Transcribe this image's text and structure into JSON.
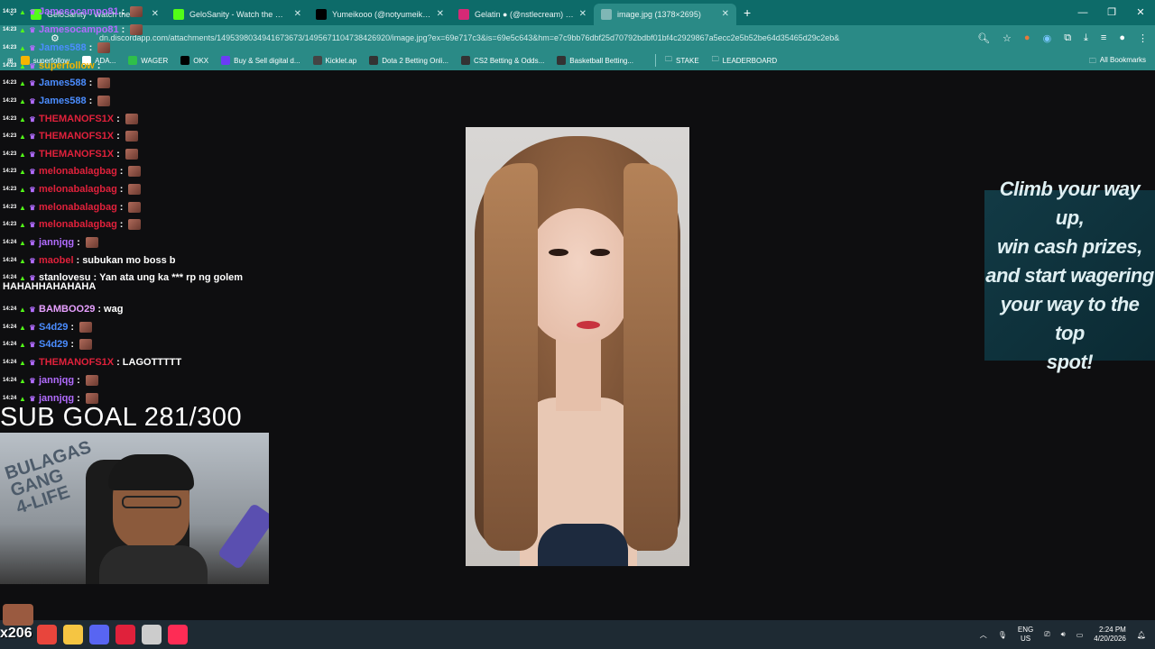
{
  "browser": {
    "tabs": [
      {
        "label": "GeloSanity - Watch the VOD",
        "icon": "kick-icon",
        "color": "#53fc18"
      },
      {
        "label": "GeloSanity - Watch the VOD",
        "icon": "kick-icon",
        "color": "#53fc18"
      },
      {
        "label": "Yumeikooo (@notyumeikooo) |",
        "icon": "tiktok-icon",
        "color": "#000000"
      },
      {
        "label": "Gelatin ● (@nstlecream) • Ins",
        "icon": "instagram-icon",
        "color": "#d62976"
      },
      {
        "label": "image.jpg (1378×2695)",
        "icon": "globe-icon",
        "color": "#7fb7b5"
      }
    ],
    "new_tab": "+",
    "url": "dn.discordapp.com/attachments/1495398034941673673/1495671104738426920/image.jpg?ex=69e717c3&is=69e5c643&hm=e7c9bb76dbf25d70792bdbf01bf4c2929867a5ecc2e5b52be64d35465d29c2eb&",
    "bookmarks": [
      {
        "label": "superfollow",
        "icon": "bookmark-icon",
        "color": "#f5b400"
      },
      {
        "label": "ADA...",
        "icon": "bookmark-icon",
        "color": "#ffffff"
      },
      {
        "label": "WAGER",
        "icon": "wager-icon",
        "color": "#2fbf4a"
      },
      {
        "label": "OKX",
        "icon": "okx-icon",
        "color": "#000000"
      },
      {
        "label": "Buy & Sell digital d...",
        "icon": "bookmark-icon",
        "color": "#6b3df5"
      },
      {
        "label": "Kicklet.ap",
        "icon": "kicklet-icon",
        "color": "#444444"
      },
      {
        "label": "Dota 2 Betting Onli...",
        "icon": "s-icon",
        "color": "#333333"
      },
      {
        "label": "CS2 Betting & Odds...",
        "icon": "s-icon",
        "color": "#333333"
      },
      {
        "label": "Basketball Betting...",
        "icon": "s-icon",
        "color": "#333333"
      }
    ],
    "folders": [
      {
        "label": "STAKE"
      },
      {
        "label": "LEADERBOARD"
      }
    ],
    "all_bookmarks": "All Bookmarks"
  },
  "chat": {
    "messages": [
      {
        "time": "14:23",
        "user": "Jamesocampo81",
        "color": "#b26cff",
        "text": "",
        "emote": true
      },
      {
        "time": "14:23",
        "user": "Jamesocampo81",
        "color": "#b26cff",
        "text": "",
        "emote": true
      },
      {
        "time": "14:23",
        "user": "James588",
        "color": "#4b8dff",
        "text": "",
        "emote": true
      },
      {
        "time": "14:23",
        "user": "superfollow",
        "color": "#f5b400",
        "text": "",
        "emote": false
      },
      {
        "time": "14:23",
        "user": "James588",
        "color": "#4b8dff",
        "text": "",
        "emote": true
      },
      {
        "time": "14:23",
        "user": "James588",
        "color": "#4b8dff",
        "text": "",
        "emote": true
      },
      {
        "time": "14:23",
        "user": "THEMANOFS1X",
        "color": "#e0213b",
        "text": "",
        "emote": true
      },
      {
        "time": "14:23",
        "user": "THEMANOFS1X",
        "color": "#e0213b",
        "text": "",
        "emote": true
      },
      {
        "time": "14:23",
        "user": "THEMANOFS1X",
        "color": "#e0213b",
        "text": "",
        "emote": true
      },
      {
        "time": "14:23",
        "user": "melonabalagbag",
        "color": "#e0213b",
        "text": "",
        "emote": true
      },
      {
        "time": "14:23",
        "user": "melonabalagbag",
        "color": "#e0213b",
        "text": "",
        "emote": true
      },
      {
        "time": "14:23",
        "user": "melonabalagbag",
        "color": "#e0213b",
        "text": "",
        "emote": true
      },
      {
        "time": "14:23",
        "user": "melonabalagbag",
        "color": "#e0213b",
        "text": "",
        "emote": true
      },
      {
        "time": "14:24",
        "user": "jannjqg",
        "color": "#b26cff",
        "text": "",
        "emote": true
      },
      {
        "time": "14:24",
        "user": "maobel",
        "color": "#e0213b",
        "text": "subukan mo boss b",
        "emote": false
      },
      {
        "time": "14:24",
        "user": "stanlovesu",
        "color": "#ffffff",
        "text": "Yan ata ung ka *** rp ng golem",
        "emote": false
      },
      {
        "time": "14:24",
        "user": "BAMBOO29",
        "color": "#e7a0ff",
        "text": "wag",
        "emote": false
      },
      {
        "time": "14:24",
        "user": "S4d29",
        "color": "#4b8dff",
        "text": "",
        "emote": true
      },
      {
        "time": "14:24",
        "user": "S4d29",
        "color": "#4b8dff",
        "text": "",
        "emote": true
      },
      {
        "time": "14:24",
        "user": "THEMANOFS1X",
        "color": "#e0213b",
        "text": "LAGOTTTTT",
        "emote": false
      },
      {
        "time": "14:24",
        "user": "jannjqg",
        "color": "#b26cff",
        "text": "",
        "emote": true
      },
      {
        "time": "14:24",
        "user": "jannjqg",
        "color": "#b26cff",
        "text": "",
        "emote": true
      }
    ],
    "wrap_text": "HAHAHHAHAHAHA",
    "separator": ":"
  },
  "sub_goal": "SUB GOAL 281/300",
  "promo": {
    "line1": "Climb your way up,",
    "line2": "win cash prizes,",
    "line3": "and start wagering",
    "line4": "your way to the top",
    "line5": "spot!"
  },
  "taskbar": {
    "badge": "x206",
    "lang_top": "ENG",
    "lang_bottom": "US",
    "time": "2:24 PM",
    "date": "4/20/2026",
    "apps": [
      {
        "name": "chrome-icon",
        "color": "#e8453c"
      },
      {
        "name": "file-explorer-icon",
        "color": "#f5c542"
      },
      {
        "name": "discord-icon",
        "color": "#5865f2"
      },
      {
        "name": "app-a-icon",
        "color": "#e0213b"
      },
      {
        "name": "obs-icon",
        "color": "#cccccc"
      },
      {
        "name": "tiktok-live-icon",
        "color": "#fe2c55"
      }
    ]
  }
}
